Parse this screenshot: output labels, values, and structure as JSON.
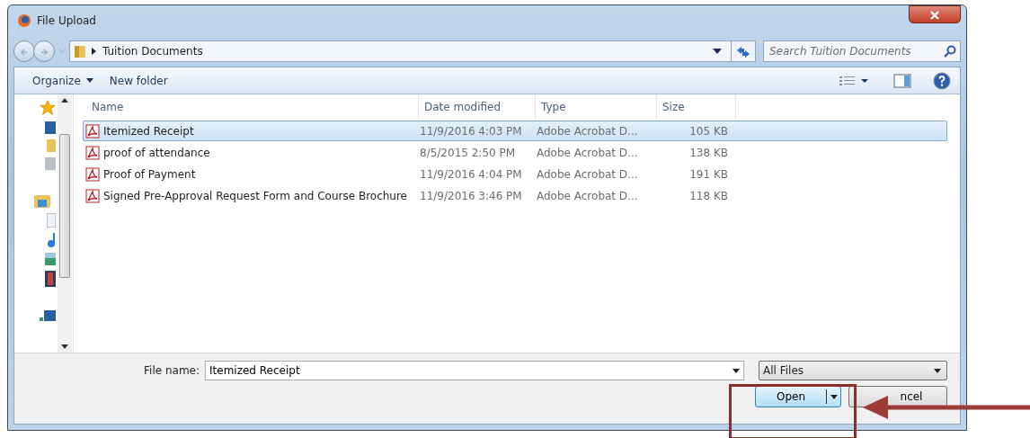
{
  "window": {
    "title": "File Upload"
  },
  "address": {
    "crumb": "Tuition Documents"
  },
  "search": {
    "placeholder": "Search Tuition Documents"
  },
  "toolbar": {
    "organize": "Organize",
    "new_folder": "New folder"
  },
  "table": {
    "columns": [
      "Name",
      "Date modified",
      "Type",
      "Size"
    ],
    "rows": [
      {
        "name": "Itemized Receipt",
        "date": "11/9/2016 4:03 PM",
        "type": "Adobe Acrobat D...",
        "size": "105 KB",
        "selected": true
      },
      {
        "name": "proof of attendance",
        "date": "8/5/2015 2:50 PM",
        "type": "Adobe Acrobat D...",
        "size": "138 KB",
        "selected": false
      },
      {
        "name": "Proof of Payment",
        "date": "11/9/2016 4:04 PM",
        "type": "Adobe Acrobat D...",
        "size": "191 KB",
        "selected": false
      },
      {
        "name": "Signed Pre-Approval Request Form and Course Brochure",
        "date": "11/9/2016 3:46 PM",
        "type": "Adobe Acrobat D...",
        "size": "118 KB",
        "selected": false
      }
    ]
  },
  "file_name": {
    "label": "File name:",
    "value": "Itemized Receipt"
  },
  "filter": {
    "value": "All Files"
  },
  "buttons": {
    "open": "Open",
    "cancel": "ncel"
  }
}
